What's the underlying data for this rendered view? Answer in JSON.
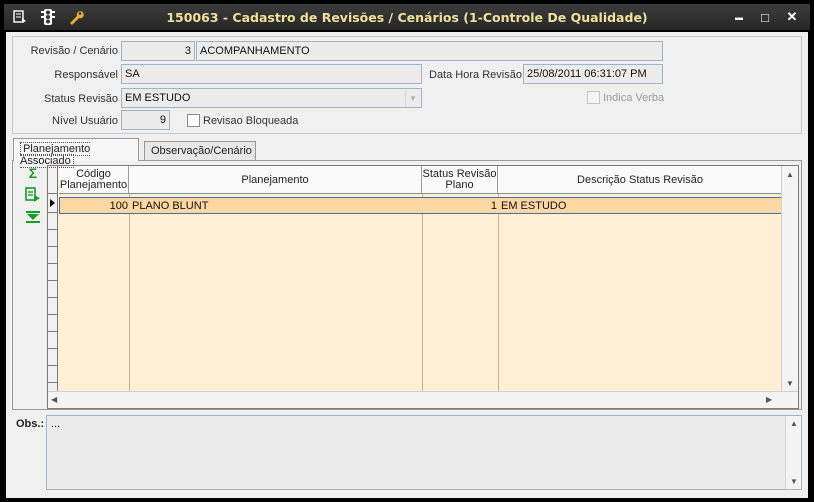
{
  "titlebar": {
    "title": "150063 - Cadastro de Revisões / Cenários (1-Controle De Qualidade)",
    "icons": [
      "menu-icon",
      "traffic-light-icon",
      "wrench-icon"
    ],
    "minimize": "▬",
    "maximize": "□",
    "close": "✕"
  },
  "form": {
    "revisao_label": "Revisão / Cenário",
    "revisao_num": "3",
    "revisao_desc": "ACOMPANHAMENTO",
    "responsavel_label": "Responsável",
    "responsavel_value": "SA",
    "data_hora_label": "Data Hora Revisão",
    "data_hora_value": "25/08/2011 06:31:07 PM",
    "status_label": "Status Revisão",
    "status_value": "EM ESTUDO",
    "indica_verba_label": "Indica Verba",
    "nivel_label": "Nível Usuário",
    "nivel_value": "9",
    "revisao_bloqueada_label": "Revisao Bloqueada"
  },
  "tabs": [
    {
      "label": "Planejamento Associado"
    },
    {
      "label": "Observação/Cenário"
    }
  ],
  "grid": {
    "headers": [
      "Código Planejamento",
      "Planejamento",
      "Status Revisão Plano",
      "Descrição Status Revisão"
    ],
    "rows": [
      {
        "codigo": "100",
        "planejamento": "PLANO BLUNT",
        "status": "1",
        "descricao": "EM ESTUDO"
      }
    ]
  },
  "obs": {
    "label": "Obs.:",
    "value": "..."
  }
}
